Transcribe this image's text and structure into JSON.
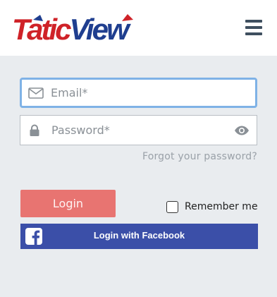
{
  "header": {
    "logo_text": "TaticView",
    "menu_icon": "hamburger-menu-icon"
  },
  "form": {
    "email": {
      "placeholder": "Email*",
      "value": "",
      "icon": "envelope-icon"
    },
    "password": {
      "placeholder": "Password*",
      "value": "",
      "icon": "lock-icon",
      "toggle_icon": "eye-icon"
    },
    "forgot_label": "Forgot your password?",
    "login_label": "Login",
    "remember_label": "Remember me",
    "remember_checked": false,
    "facebook_label": "Login with Facebook",
    "facebook_icon": "facebook-icon"
  },
  "colors": {
    "background": "#e9ecef",
    "login_button": "#e87471",
    "facebook_button": "#3b4fa8",
    "logo_red": "#cf2228",
    "logo_blue": "#1f3e8f",
    "focus_border": "#7fb2e6"
  }
}
